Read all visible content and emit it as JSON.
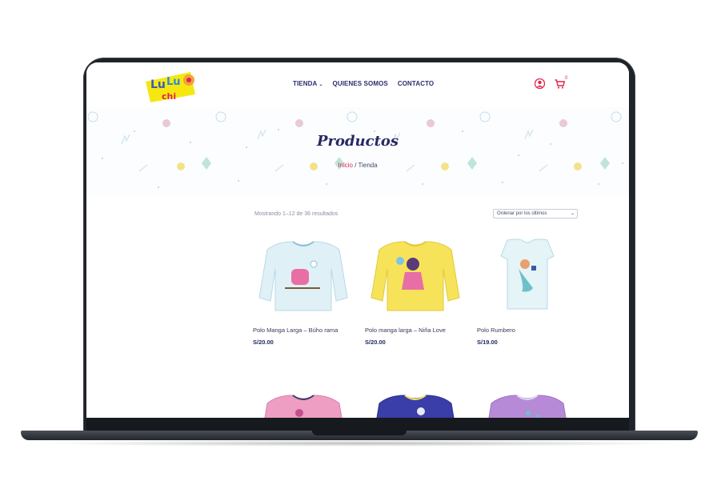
{
  "header": {
    "logo_text": "Lu Lu Chi",
    "nav": [
      {
        "label": "TIENDA",
        "has_dropdown": true
      },
      {
        "label": "QUIENES SOMOS"
      },
      {
        "label": "CONTACTO"
      }
    ],
    "cart_count": "0",
    "icons": [
      "user-icon",
      "cart-icon"
    ],
    "accent_color": "#e2244f",
    "nav_color": "#2a2e6e"
  },
  "hero": {
    "title": "Productos",
    "breadcrumb_home": "Inicio",
    "breadcrumb_sep": " / ",
    "breadcrumb_current": "Tienda"
  },
  "shop": {
    "result_count": "Mostrando 1–12 de 36 resultados",
    "sort_selected": "Ordenar por los últimos",
    "products": [
      {
        "name": "Polo Manga Larga – Búho rama",
        "price": "S/20.00",
        "color": "#dff1f6"
      },
      {
        "name": "Polo manga larga – Niña Love",
        "price": "S/20.00",
        "color": "#f6e35a"
      },
      {
        "name": "Polo Rumbero",
        "price": "S/19.00",
        "color": "#dff1f6"
      },
      {
        "color": "#ee9ec2"
      },
      {
        "color": "#3a3ea8"
      },
      {
        "color": "#b78ad8"
      }
    ]
  }
}
